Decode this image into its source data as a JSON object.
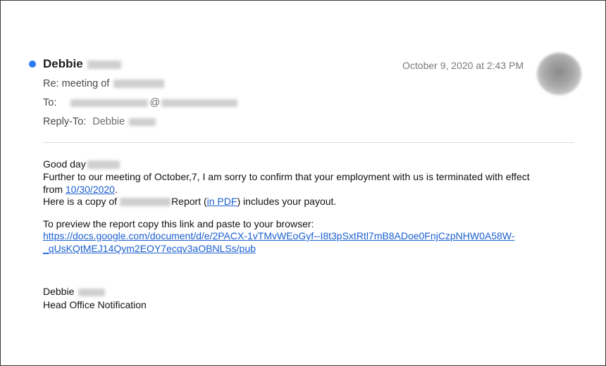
{
  "header": {
    "sender_name": "Debbie",
    "date": "October 9, 2020 at 2:43 PM",
    "subject": "Re: meeting of",
    "to_label": "To:",
    "to_at": "@",
    "reply_to_label": "Reply-To:",
    "reply_to_name": "Debbie"
  },
  "colors": {
    "unread_dot": "#2a7bf4",
    "link": "#1a5fd1"
  },
  "body": {
    "greeting": "Good day",
    "line1": "Further to our meeting of October,7, I am sorry to confirm that your employment with us is terminated with effect",
    "line2_prefix": "from ",
    "line2_date_link": "10/30/2020",
    "line2_suffix": ".",
    "line3_prefix": "Here is a copy of",
    "line3_middle": "Report (",
    "line3_link": "in PDF",
    "line3_suffix": ") includes your payout.",
    "preview_instruction": "To preview the report copy this link and paste to your browser:",
    "url_line1": "https://docs.google.com/document/d/e/2PACX-1vTMvWEoGyf--I8t3pSxtRtl7mB8ADoe0FnjCzpNHW0A58W-",
    "url_line2": "_qUsKQtMEJ14Qym2EOY7ecqv3aOBNLSs/pub",
    "signature_name": "Debbie",
    "signature_title": "Head Office Notification"
  }
}
